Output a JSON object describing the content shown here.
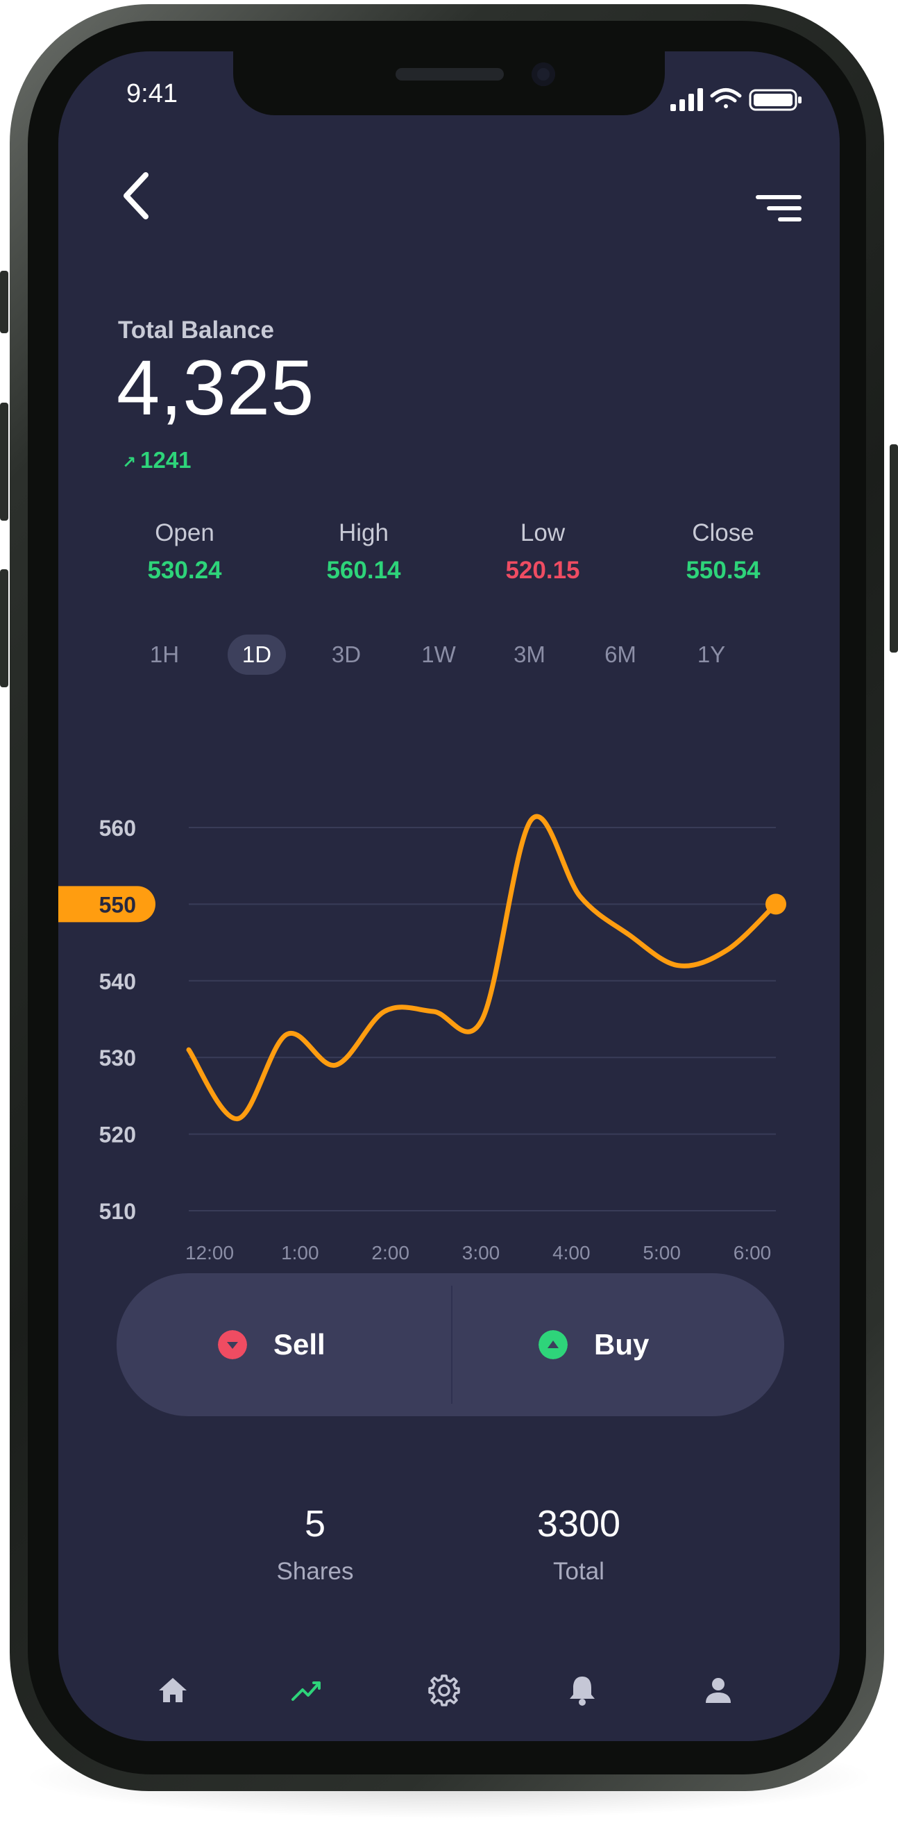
{
  "status_bar": {
    "time": "9:41"
  },
  "balance": {
    "label": "Total Balance",
    "value": "4,325",
    "change": "1241"
  },
  "stats": [
    {
      "label": "Open",
      "value": "530.24",
      "color": "#2ed47a"
    },
    {
      "label": "High",
      "value": "560.14",
      "color": "#2ed47a"
    },
    {
      "label": "Low",
      "value": "520.15",
      "color": "#ef4c62"
    },
    {
      "label": "Close",
      "value": "550.54",
      "color": "#2ed47a"
    }
  ],
  "ranges": [
    "1H",
    "1D",
    "3D",
    "1W",
    "3M",
    "6M",
    "1Y"
  ],
  "active_range": "1D",
  "chart_data": {
    "type": "line",
    "x": [
      "12:00",
      "12:30",
      "1:00",
      "1:30",
      "2:00",
      "2:30",
      "3:00",
      "3:30",
      "4:00",
      "4:30",
      "5:00",
      "5:30",
      "6:00"
    ],
    "values": [
      531,
      522,
      533,
      529,
      536,
      536,
      535,
      561,
      551,
      546,
      542,
      544,
      550
    ],
    "x_ticks": [
      "12:00",
      "1:00",
      "2:00",
      "3:00",
      "4:00",
      "5:00",
      "6:00"
    ],
    "y_ticks": [
      510,
      520,
      530,
      540,
      550,
      560
    ],
    "ylim": [
      510,
      560
    ],
    "current_value": "550",
    "line_color": "#ff9d10",
    "grid": true
  },
  "trade": {
    "sell_label": "Sell",
    "buy_label": "Buy"
  },
  "summary": {
    "shares_value": "5",
    "shares_label": "Shares",
    "total_value": "3300",
    "total_label": "Total"
  },
  "nav": [
    "home-icon",
    "chart-icon",
    "settings-icon",
    "bell-icon",
    "user-icon"
  ],
  "colors": {
    "background": "#262840",
    "accent": "#ff9d10",
    "positive": "#2ed47a",
    "negative": "#ef4c62"
  }
}
